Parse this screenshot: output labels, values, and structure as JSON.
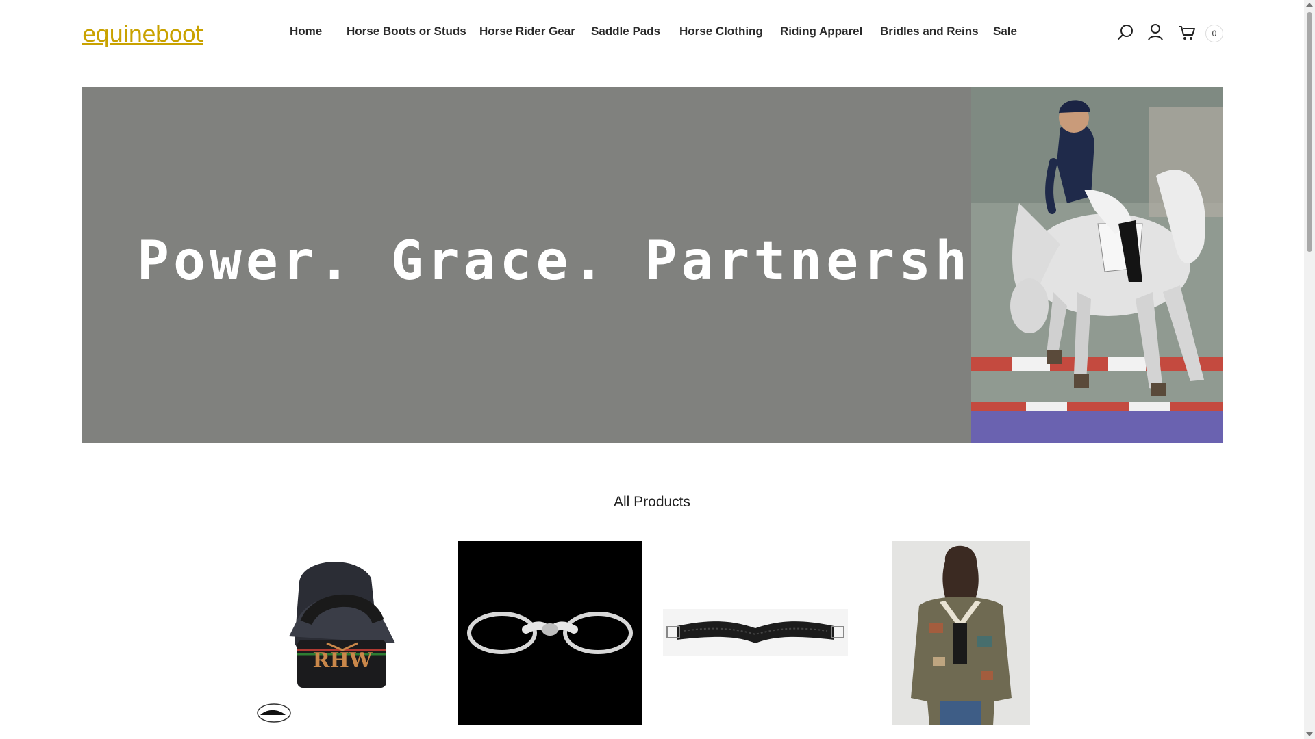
{
  "site": {
    "logo_text": "equineboot",
    "logo_color": "#c9a200"
  },
  "nav": {
    "items": [
      {
        "label": "Home"
      },
      {
        "label": "Horse Boots or Studs"
      },
      {
        "label": "Horse Rider Gear"
      },
      {
        "label": "Saddle Pads"
      },
      {
        "label": "Horse Clothing"
      },
      {
        "label": "Riding Apparel"
      },
      {
        "label": "Bridles and Reins"
      },
      {
        "label": "Sale"
      }
    ]
  },
  "header_icons": {
    "search": "search-icon",
    "account": "user-icon",
    "cart": "cart-icon",
    "cart_count": "0"
  },
  "hero": {
    "headline": "Power. Grace. Partnership",
    "background_color": "#80817e",
    "photo": "show-jumping-rider-on-grey-horse"
  },
  "products_section": {
    "title": "All Products",
    "items": [
      {
        "image": "black-rhw-trucker-cap",
        "logo_text": "RHW"
      },
      {
        "image": "eggbutt-snaffle-bit"
      },
      {
        "image": "black-anatomic-girth"
      },
      {
        "image": "woman-aztec-print-jacket"
      }
    ]
  }
}
